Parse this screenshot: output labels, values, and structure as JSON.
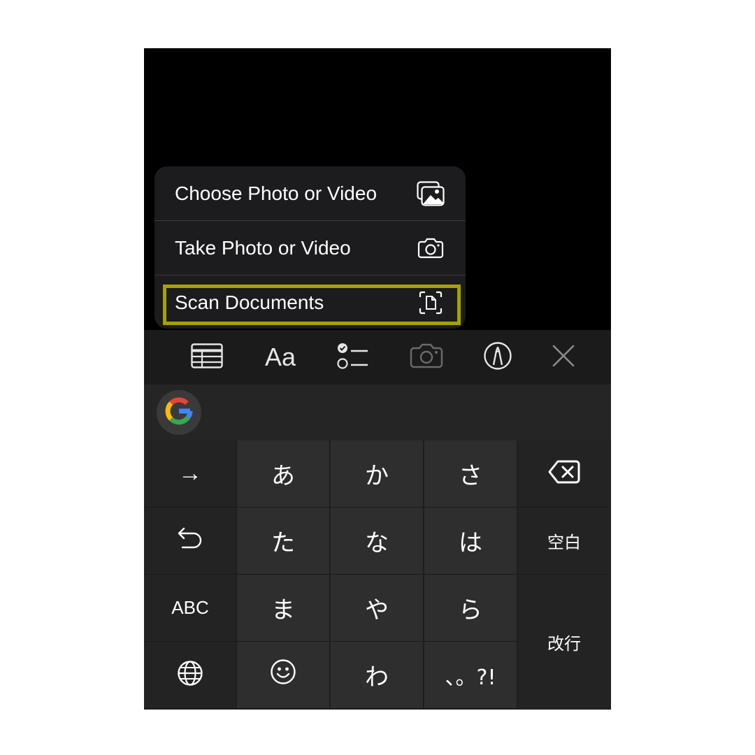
{
  "menu": {
    "items": [
      {
        "label": "Choose Photo or Video",
        "icon": "photo-library-icon"
      },
      {
        "label": "Take Photo or Video",
        "icon": "camera-icon"
      },
      {
        "label": "Scan Documents",
        "icon": "scan-document-icon"
      }
    ],
    "highlight_color": "#a7a200"
  },
  "toolbar": {
    "format_label": "Aa",
    "icons": [
      "table-icon",
      "format-text-icon",
      "checklist-icon",
      "camera-icon",
      "markup-pen-icon",
      "close-icon"
    ]
  },
  "suggestion_bar": {
    "icon": "google-logo-icon"
  },
  "keyboard": {
    "row1": [
      "→",
      "あ",
      "か",
      "さ"
    ],
    "row2": [
      "た",
      "な",
      "は"
    ],
    "space": "空白",
    "row3": [
      "ABC",
      "ま",
      "や",
      "ら"
    ],
    "enter": "改行",
    "row4": [
      "わ",
      "、。?!"
    ],
    "icons": [
      "backspace-icon",
      "undo-icon",
      "globe-icon",
      "emoji-icon"
    ]
  }
}
